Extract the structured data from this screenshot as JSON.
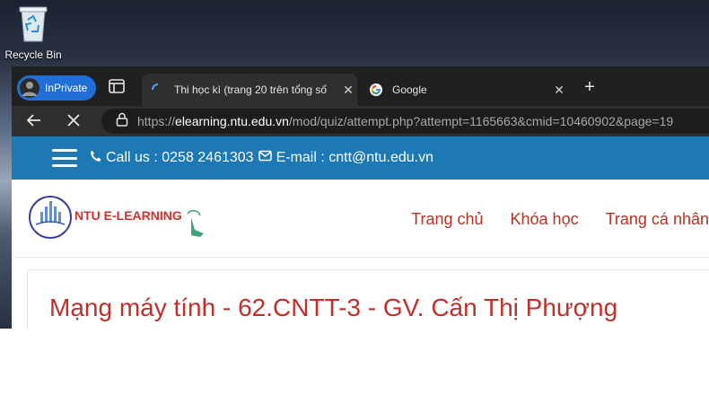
{
  "desktop": {
    "recycle_bin_label": "Recycle Bin"
  },
  "browser": {
    "inprivate_label": "InPrivate",
    "tabs": [
      {
        "title": "Thi học kì (trang 20 trên tổng số",
        "favicon": "moodle-favicon-icon",
        "active": true
      },
      {
        "title": "Google",
        "favicon": "google-favicon-icon",
        "active": false
      }
    ],
    "url": {
      "scheme": "https://",
      "host": "elearning.ntu.edu.vn",
      "path": "/mod/quiz/attempt.php?attempt=1165663&cmid=10460902&page=19"
    }
  },
  "site": {
    "call_us": "Call us : 0258 2461303",
    "email": "E-mail : cntt@ntu.edu.vn",
    "brand": "NTU E-LEARNING",
    "menu": [
      "Trang chủ",
      "Khóa học",
      "Trang cá nhân"
    ],
    "course_title": "Mạng máy tính - 62.CNTT-3 - GV. Cấn Thị Phượng"
  },
  "colors": {
    "topbar": "#1d78b3",
    "accent_red": "#c0302b",
    "inprivate_badge": "#1f6fd6"
  }
}
